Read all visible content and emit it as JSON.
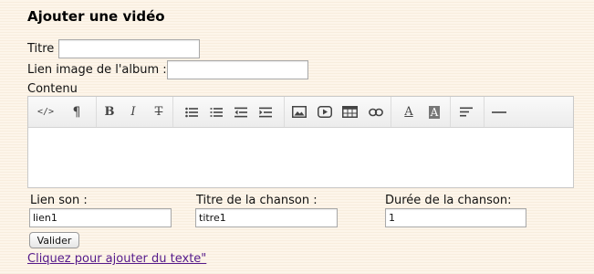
{
  "heading": "Ajouter une vidéo",
  "form": {
    "titre_label": "Titre",
    "titre_value": "",
    "album_label": "Lien image de l'album :",
    "album_value": "",
    "contenu_label": "Contenu"
  },
  "toolbar": {
    "buttons": [
      {
        "name": "html-source",
        "label": "</>"
      },
      {
        "name": "paragraph-format",
        "label": "¶"
      },
      {
        "name": "bold",
        "label": "B"
      },
      {
        "name": "italic",
        "label": "I"
      },
      {
        "name": "strikethrough",
        "label": "T"
      },
      {
        "name": "unordered-list",
        "icon": "bullet-list-icon"
      },
      {
        "name": "ordered-list",
        "icon": "numbered-list-icon"
      },
      {
        "name": "outdent",
        "icon": "outdent-icon"
      },
      {
        "name": "indent",
        "icon": "indent-icon"
      },
      {
        "name": "image",
        "icon": "image-icon"
      },
      {
        "name": "video",
        "icon": "video-icon"
      },
      {
        "name": "table",
        "icon": "table-icon"
      },
      {
        "name": "link",
        "icon": "link-icon"
      },
      {
        "name": "font-color",
        "label": "A"
      },
      {
        "name": "background-color",
        "label": "A"
      },
      {
        "name": "alignment",
        "icon": "align-icon"
      },
      {
        "name": "horizontal-rule",
        "icon": "horizontal-rule-icon"
      }
    ]
  },
  "song": {
    "lien_label": "Lien son :",
    "lien_value": "lien1",
    "titre_label": "Titre de la chanson :",
    "titre_value": "titre1",
    "duree_label": "Durée de la chanson:",
    "duree_value": "1"
  },
  "valider_label": "Valider",
  "add_text_link": "Cliquez pour ajouter du texte\""
}
